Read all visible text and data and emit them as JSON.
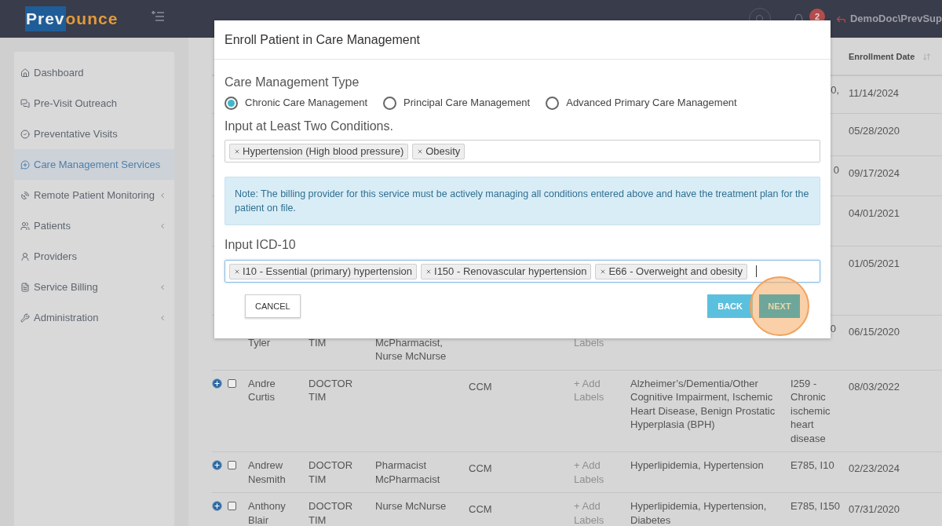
{
  "header": {
    "logo": {
      "part_1": "Prev",
      "part_2": "ounce"
    },
    "notification_count": "2",
    "user": "DemoDoc\\PrevSup"
  },
  "sidebar": {
    "items": [
      {
        "label": "Dashboard",
        "selected": false,
        "expandable": false
      },
      {
        "label": "Pre-Visit Outreach",
        "selected": false,
        "expandable": false
      },
      {
        "label": "Preventative Visits",
        "selected": false,
        "expandable": false
      },
      {
        "label": "Care Management Services",
        "selected": true,
        "expandable": false
      },
      {
        "label": "Remote Patient Monitoring",
        "selected": false,
        "expandable": true
      },
      {
        "label": "Patients",
        "selected": false,
        "expandable": true
      },
      {
        "label": "Providers",
        "selected": false,
        "expandable": false
      },
      {
        "label": "Service Billing",
        "selected": false,
        "expandable": true
      },
      {
        "label": "Administration",
        "selected": false,
        "expandable": true
      }
    ]
  },
  "table": {
    "columns": [
      {
        "label": "Enrollment Date"
      }
    ],
    "rows": [
      {
        "kind": "covered",
        "codes": "0,",
        "date": "11/14/2024"
      },
      {
        "kind": "covered",
        "date": "05/28/2020"
      },
      {
        "kind": "covered",
        "codes": "0",
        "date": "09/17/2024"
      },
      {
        "kind": "covered",
        "date": "04/01/2021"
      },
      {
        "kind": "covered",
        "date": "01/05/2021"
      },
      {
        "kind": "partial",
        "name": "Tyler",
        "provider": "TIM",
        "care_team": "McPharmacist, Nurse McNurse",
        "labels": "Labels",
        "codes": "0",
        "date": "06/15/2020"
      },
      {
        "kind": "full",
        "selected": false,
        "name": "Andre Curtis",
        "provider": "DOCTOR TIM",
        "care_team": "",
        "program": "CCM",
        "labels": "+ Add Labels",
        "conditions": "Alzheimer’s/Dementia/Other Cognitive Impairment, Ischemic Heart Disease, Benign Prostatic Hyperplasia (BPH)",
        "codes": "I259 - Chronic ischemic heart disease",
        "date": "08/03/2022"
      },
      {
        "kind": "full",
        "selected": false,
        "name": "Andrew Nesmith",
        "provider": "DOCTOR TIM",
        "care_team": "Pharmacist McPharmacist",
        "program": "CCM",
        "labels": "+ Add Labels",
        "conditions": "Hyperlipidemia, Hypertension",
        "codes": "E785, I10",
        "date": "02/23/2024"
      },
      {
        "kind": "full",
        "selected": false,
        "name": "Anthony Blair",
        "provider": "DOCTOR TIM",
        "care_team": "Nurse McNurse",
        "program": "CCM",
        "labels": "+ Add Labels",
        "conditions": "Hyperlipidemia, Hypertension, Diabetes",
        "codes": "E785, I150",
        "date": "07/31/2020"
      }
    ]
  },
  "modal": {
    "title": "Enroll Patient in Care Management",
    "type_label": "Care Management Type",
    "types": [
      {
        "label": "Chronic Care Management",
        "selected": true
      },
      {
        "label": "Principal Care Management",
        "selected": false
      },
      {
        "label": "Advanced Primary Care Management",
        "selected": false
      }
    ],
    "conditions_label": "Input at Least Two Conditions.",
    "conditions": [
      "Hypertension (High blood pressure)",
      "Obesity"
    ],
    "note": "Note: The billing provider for this service must be actively managing all conditions entered above and have the treatment plan for the patient on file.",
    "icd_label": "Input ICD-10",
    "icd_codes": [
      "I10 - Essential (primary) hypertension",
      "I150 - Renovascular hypertension",
      "E66 - Overweight and obesity"
    ],
    "buttons": {
      "cancel": "CANCEL",
      "back": "BACK",
      "next": "NEXT"
    }
  }
}
